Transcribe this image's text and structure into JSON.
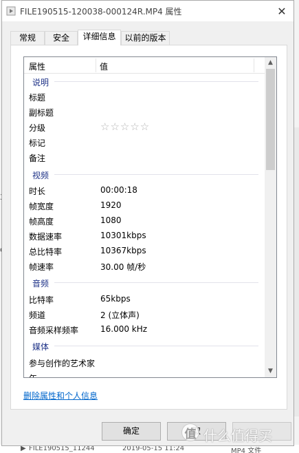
{
  "window": {
    "title": "FILE190515-120038-000124R.MP4 属性",
    "close_glyph": "✕"
  },
  "tabs": [
    {
      "label": "常规",
      "active": false
    },
    {
      "label": "安全",
      "active": false
    },
    {
      "label": "详细信息",
      "active": true
    },
    {
      "label": "以前的版本",
      "active": false
    }
  ],
  "list": {
    "columns": {
      "property": "属性",
      "value": "值"
    },
    "groups": [
      {
        "name": "说明",
        "rows": [
          {
            "key": "标题",
            "value": ""
          },
          {
            "key": "副标题",
            "value": ""
          },
          {
            "key": "分级",
            "value": "☆☆☆☆☆",
            "rating_stars": 0
          },
          {
            "key": "标记",
            "value": ""
          },
          {
            "key": "备注",
            "value": ""
          }
        ]
      },
      {
        "name": "视频",
        "rows": [
          {
            "key": "时长",
            "value": "00:00:18"
          },
          {
            "key": "帧宽度",
            "value": "1920"
          },
          {
            "key": "帧高度",
            "value": "1080"
          },
          {
            "key": "数据速率",
            "value": "10301kbps"
          },
          {
            "key": "总比特率",
            "value": "10367kbps"
          },
          {
            "key": "帧速率",
            "value": "30.00 帧/秒"
          }
        ]
      },
      {
        "name": "音频",
        "rows": [
          {
            "key": "比特率",
            "value": "65kbps"
          },
          {
            "key": "频道",
            "value": "2 (立体声)"
          },
          {
            "key": "音频采样频率",
            "value": "16.000 kHz"
          }
        ]
      },
      {
        "name": "媒体",
        "rows": [
          {
            "key": "参与创作的艺术家",
            "value": ""
          },
          {
            "key": "年",
            "value": ""
          }
        ]
      }
    ],
    "scroll_position": 0
  },
  "remove_link": "删除属性和个人信息",
  "buttons": {
    "ok": "确定",
    "cancel": "取",
    "apply": ""
  },
  "watermark": {
    "glyph": "值",
    "text": "什么值得买"
  },
  "background": {
    "bottom_row": [
      "FILE190515_11244",
      "2019-05-15 11:24",
      "MP4 文件"
    ],
    "left_fragments": [
      "30",
      "c"
    ]
  },
  "colors": {
    "link": "#0066cc",
    "group_heading": "#1e3287",
    "stars": "#b5b5b5"
  }
}
